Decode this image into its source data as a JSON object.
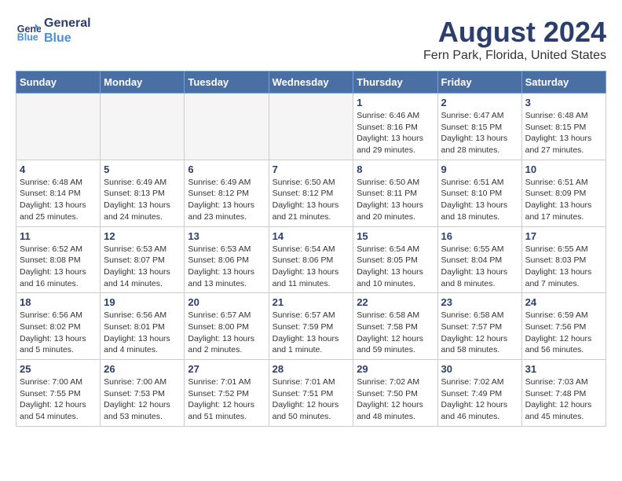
{
  "header": {
    "logo_line1": "General",
    "logo_line2": "Blue",
    "month": "August 2024",
    "location": "Fern Park, Florida, United States"
  },
  "weekdays": [
    "Sunday",
    "Monday",
    "Tuesday",
    "Wednesday",
    "Thursday",
    "Friday",
    "Saturday"
  ],
  "weeks": [
    [
      {
        "day": "",
        "info": ""
      },
      {
        "day": "",
        "info": ""
      },
      {
        "day": "",
        "info": ""
      },
      {
        "day": "",
        "info": ""
      },
      {
        "day": "1",
        "info": "Sunrise: 6:46 AM\nSunset: 8:16 PM\nDaylight: 13 hours\nand 29 minutes."
      },
      {
        "day": "2",
        "info": "Sunrise: 6:47 AM\nSunset: 8:15 PM\nDaylight: 13 hours\nand 28 minutes."
      },
      {
        "day": "3",
        "info": "Sunrise: 6:48 AM\nSunset: 8:15 PM\nDaylight: 13 hours\nand 27 minutes."
      }
    ],
    [
      {
        "day": "4",
        "info": "Sunrise: 6:48 AM\nSunset: 8:14 PM\nDaylight: 13 hours\nand 25 minutes."
      },
      {
        "day": "5",
        "info": "Sunrise: 6:49 AM\nSunset: 8:13 PM\nDaylight: 13 hours\nand 24 minutes."
      },
      {
        "day": "6",
        "info": "Sunrise: 6:49 AM\nSunset: 8:12 PM\nDaylight: 13 hours\nand 23 minutes."
      },
      {
        "day": "7",
        "info": "Sunrise: 6:50 AM\nSunset: 8:12 PM\nDaylight: 13 hours\nand 21 minutes."
      },
      {
        "day": "8",
        "info": "Sunrise: 6:50 AM\nSunset: 8:11 PM\nDaylight: 13 hours\nand 20 minutes."
      },
      {
        "day": "9",
        "info": "Sunrise: 6:51 AM\nSunset: 8:10 PM\nDaylight: 13 hours\nand 18 minutes."
      },
      {
        "day": "10",
        "info": "Sunrise: 6:51 AM\nSunset: 8:09 PM\nDaylight: 13 hours\nand 17 minutes."
      }
    ],
    [
      {
        "day": "11",
        "info": "Sunrise: 6:52 AM\nSunset: 8:08 PM\nDaylight: 13 hours\nand 16 minutes."
      },
      {
        "day": "12",
        "info": "Sunrise: 6:53 AM\nSunset: 8:07 PM\nDaylight: 13 hours\nand 14 minutes."
      },
      {
        "day": "13",
        "info": "Sunrise: 6:53 AM\nSunset: 8:06 PM\nDaylight: 13 hours\nand 13 minutes."
      },
      {
        "day": "14",
        "info": "Sunrise: 6:54 AM\nSunset: 8:06 PM\nDaylight: 13 hours\nand 11 minutes."
      },
      {
        "day": "15",
        "info": "Sunrise: 6:54 AM\nSunset: 8:05 PM\nDaylight: 13 hours\nand 10 minutes."
      },
      {
        "day": "16",
        "info": "Sunrise: 6:55 AM\nSunset: 8:04 PM\nDaylight: 13 hours\nand 8 minutes."
      },
      {
        "day": "17",
        "info": "Sunrise: 6:55 AM\nSunset: 8:03 PM\nDaylight: 13 hours\nand 7 minutes."
      }
    ],
    [
      {
        "day": "18",
        "info": "Sunrise: 6:56 AM\nSunset: 8:02 PM\nDaylight: 13 hours\nand 5 minutes."
      },
      {
        "day": "19",
        "info": "Sunrise: 6:56 AM\nSunset: 8:01 PM\nDaylight: 13 hours\nand 4 minutes."
      },
      {
        "day": "20",
        "info": "Sunrise: 6:57 AM\nSunset: 8:00 PM\nDaylight: 13 hours\nand 2 minutes."
      },
      {
        "day": "21",
        "info": "Sunrise: 6:57 AM\nSunset: 7:59 PM\nDaylight: 13 hours\nand 1 minute."
      },
      {
        "day": "22",
        "info": "Sunrise: 6:58 AM\nSunset: 7:58 PM\nDaylight: 12 hours\nand 59 minutes."
      },
      {
        "day": "23",
        "info": "Sunrise: 6:58 AM\nSunset: 7:57 PM\nDaylight: 12 hours\nand 58 minutes."
      },
      {
        "day": "24",
        "info": "Sunrise: 6:59 AM\nSunset: 7:56 PM\nDaylight: 12 hours\nand 56 minutes."
      }
    ],
    [
      {
        "day": "25",
        "info": "Sunrise: 7:00 AM\nSunset: 7:55 PM\nDaylight: 12 hours\nand 54 minutes."
      },
      {
        "day": "26",
        "info": "Sunrise: 7:00 AM\nSunset: 7:53 PM\nDaylight: 12 hours\nand 53 minutes."
      },
      {
        "day": "27",
        "info": "Sunrise: 7:01 AM\nSunset: 7:52 PM\nDaylight: 12 hours\nand 51 minutes."
      },
      {
        "day": "28",
        "info": "Sunrise: 7:01 AM\nSunset: 7:51 PM\nDaylight: 12 hours\nand 50 minutes."
      },
      {
        "day": "29",
        "info": "Sunrise: 7:02 AM\nSunset: 7:50 PM\nDaylight: 12 hours\nand 48 minutes."
      },
      {
        "day": "30",
        "info": "Sunrise: 7:02 AM\nSunset: 7:49 PM\nDaylight: 12 hours\nand 46 minutes."
      },
      {
        "day": "31",
        "info": "Sunrise: 7:03 AM\nSunset: 7:48 PM\nDaylight: 12 hours\nand 45 minutes."
      }
    ]
  ]
}
